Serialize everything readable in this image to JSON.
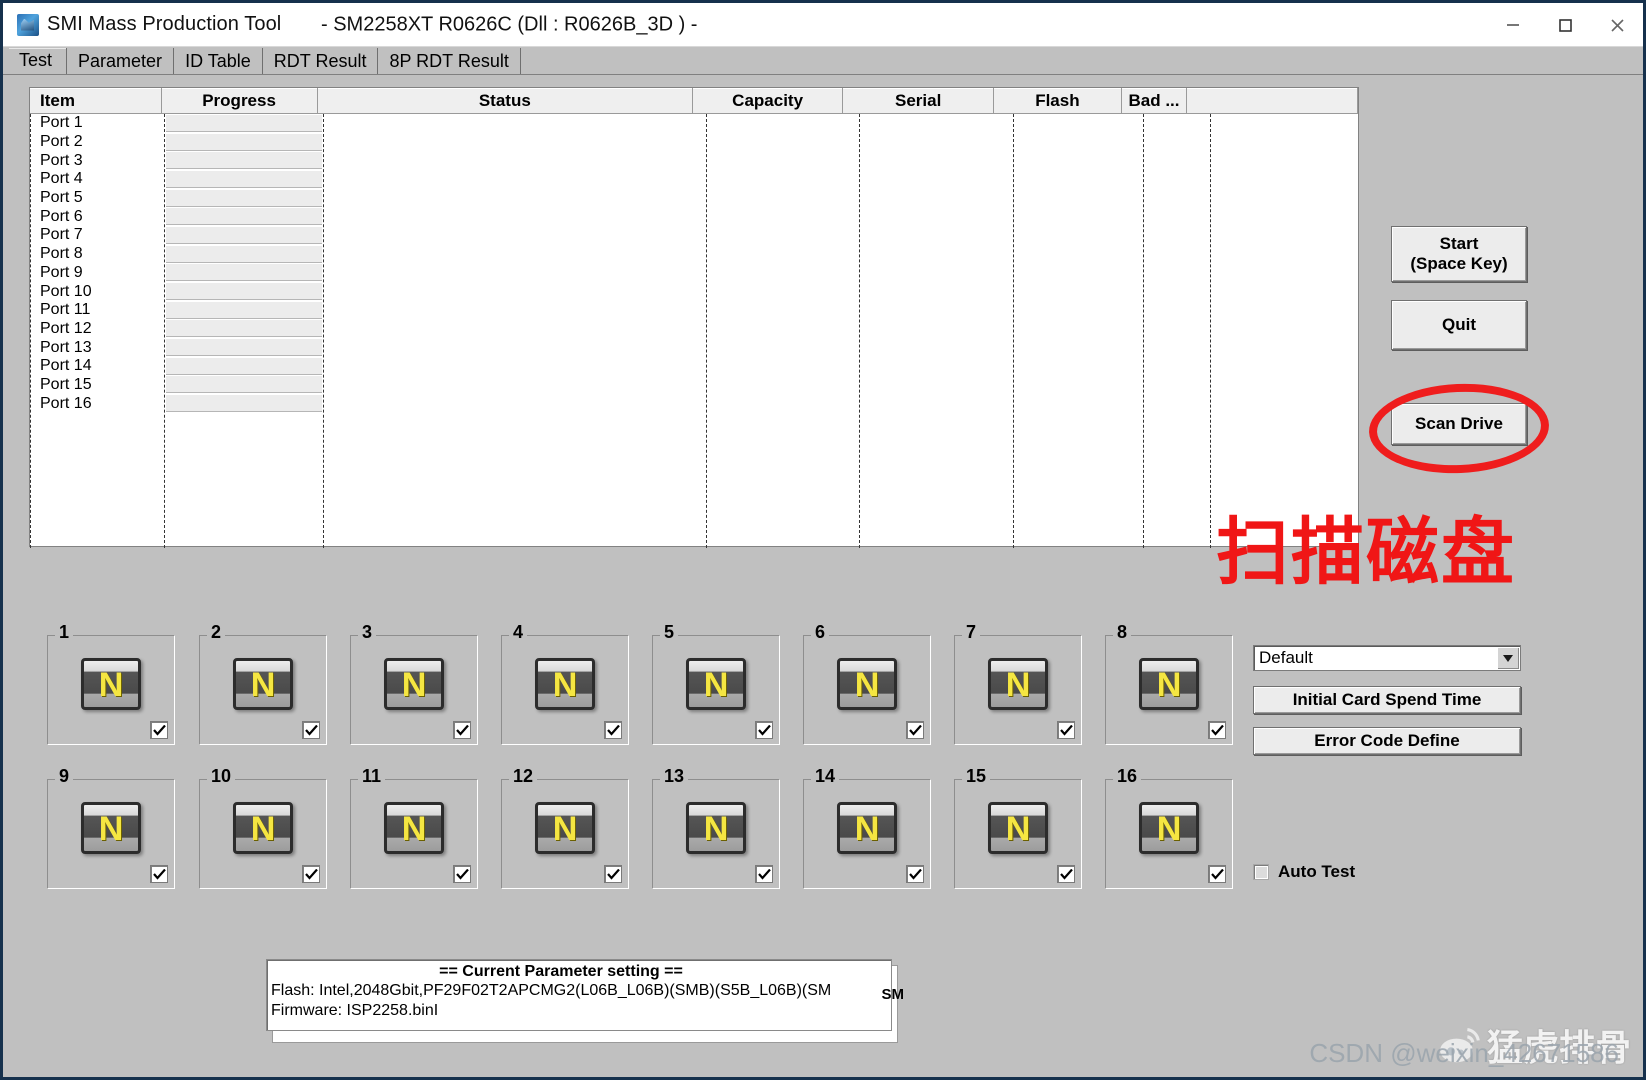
{
  "window": {
    "title": "SMI Mass Production Tool",
    "subtitle": "- SM2258XT   R0626C    (Dll : R0626B_3D ) -",
    "minimize_label": "minimize",
    "maximize_label": "maximize",
    "close_label": "close"
  },
  "tabs": [
    {
      "label": "Test",
      "active": true
    },
    {
      "label": "Parameter",
      "active": false
    },
    {
      "label": "ID Table",
      "active": false
    },
    {
      "label": "RDT Result",
      "active": false
    },
    {
      "label": "8P RDT Result",
      "active": false
    }
  ],
  "list": {
    "columns": [
      "Item",
      "Progress",
      "Status",
      "Capacity",
      "Serial",
      "Flash",
      "Bad ..."
    ],
    "rows": [
      {
        "item": "Port 1",
        "progress": "",
        "status": "",
        "capacity": "",
        "serial": "",
        "flash": "",
        "bad": ""
      },
      {
        "item": "Port 2",
        "progress": "",
        "status": "",
        "capacity": "",
        "serial": "",
        "flash": "",
        "bad": ""
      },
      {
        "item": "Port 3",
        "progress": "",
        "status": "",
        "capacity": "",
        "serial": "",
        "flash": "",
        "bad": ""
      },
      {
        "item": "Port 4",
        "progress": "",
        "status": "",
        "capacity": "",
        "serial": "",
        "flash": "",
        "bad": ""
      },
      {
        "item": "Port 5",
        "progress": "",
        "status": "",
        "capacity": "",
        "serial": "",
        "flash": "",
        "bad": ""
      },
      {
        "item": "Port 6",
        "progress": "",
        "status": "",
        "capacity": "",
        "serial": "",
        "flash": "",
        "bad": ""
      },
      {
        "item": "Port 7",
        "progress": "",
        "status": "",
        "capacity": "",
        "serial": "",
        "flash": "",
        "bad": ""
      },
      {
        "item": "Port 8",
        "progress": "",
        "status": "",
        "capacity": "",
        "serial": "",
        "flash": "",
        "bad": ""
      },
      {
        "item": "Port 9",
        "progress": "",
        "status": "",
        "capacity": "",
        "serial": "",
        "flash": "",
        "bad": ""
      },
      {
        "item": "Port 10",
        "progress": "",
        "status": "",
        "capacity": "",
        "serial": "",
        "flash": "",
        "bad": ""
      },
      {
        "item": "Port 11",
        "progress": "",
        "status": "",
        "capacity": "",
        "serial": "",
        "flash": "",
        "bad": ""
      },
      {
        "item": "Port 12",
        "progress": "",
        "status": "",
        "capacity": "",
        "serial": "",
        "flash": "",
        "bad": ""
      },
      {
        "item": "Port 13",
        "progress": "",
        "status": "",
        "capacity": "",
        "serial": "",
        "flash": "",
        "bad": ""
      },
      {
        "item": "Port 14",
        "progress": "",
        "status": "",
        "capacity": "",
        "serial": "",
        "flash": "",
        "bad": ""
      },
      {
        "item": "Port 15",
        "progress": "",
        "status": "",
        "capacity": "",
        "serial": "",
        "flash": "",
        "bad": ""
      },
      {
        "item": "Port 16",
        "progress": "",
        "status": "",
        "capacity": "",
        "serial": "",
        "flash": "",
        "bad": ""
      }
    ]
  },
  "buttons": {
    "start": "Start\n(Space Key)",
    "start_line1": "Start",
    "start_line2": "(Space Key)",
    "quit": "Quit",
    "scan_drive": "Scan Drive",
    "initial_card_spend_time": "Initial Card Spend Time",
    "error_code_define": "Error Code Define"
  },
  "annotation": {
    "text": "扫描磁盘",
    "color": "#f01616",
    "ellipse_color": "#ef1d1d"
  },
  "slots": [
    {
      "num": "1",
      "icon": "N",
      "checked": true
    },
    {
      "num": "2",
      "icon": "N",
      "checked": true
    },
    {
      "num": "3",
      "icon": "N",
      "checked": true
    },
    {
      "num": "4",
      "icon": "N",
      "checked": true
    },
    {
      "num": "5",
      "icon": "N",
      "checked": true
    },
    {
      "num": "6",
      "icon": "N",
      "checked": true
    },
    {
      "num": "7",
      "icon": "N",
      "checked": true
    },
    {
      "num": "8",
      "icon": "N",
      "checked": true
    },
    {
      "num": "9",
      "icon": "N",
      "checked": true
    },
    {
      "num": "10",
      "icon": "N",
      "checked": true
    },
    {
      "num": "11",
      "icon": "N",
      "checked": true
    },
    {
      "num": "12",
      "icon": "N",
      "checked": true
    },
    {
      "num": "13",
      "icon": "N",
      "checked": true
    },
    {
      "num": "14",
      "icon": "N",
      "checked": true
    },
    {
      "num": "15",
      "icon": "N",
      "checked": true
    },
    {
      "num": "16",
      "icon": "N",
      "checked": true
    }
  ],
  "preset": {
    "selected": "Default",
    "options": [
      "Default"
    ]
  },
  "auto_test": {
    "label": "Auto Test",
    "checked": false
  },
  "parameter_box": {
    "title": "== Current Parameter setting ==",
    "flash_line": "Flash:   Intel,2048Gbit,PF29F02T2APCMG2(L06B_L06B)(SMB)(S5B_L06B)(SM",
    "firmware_line": "Firmware:   ISP2258.binI",
    "overflow_text": "SM"
  },
  "watermark": {
    "text": "猛虎排骨",
    "credit": "CSDN @weixin_42671586"
  }
}
